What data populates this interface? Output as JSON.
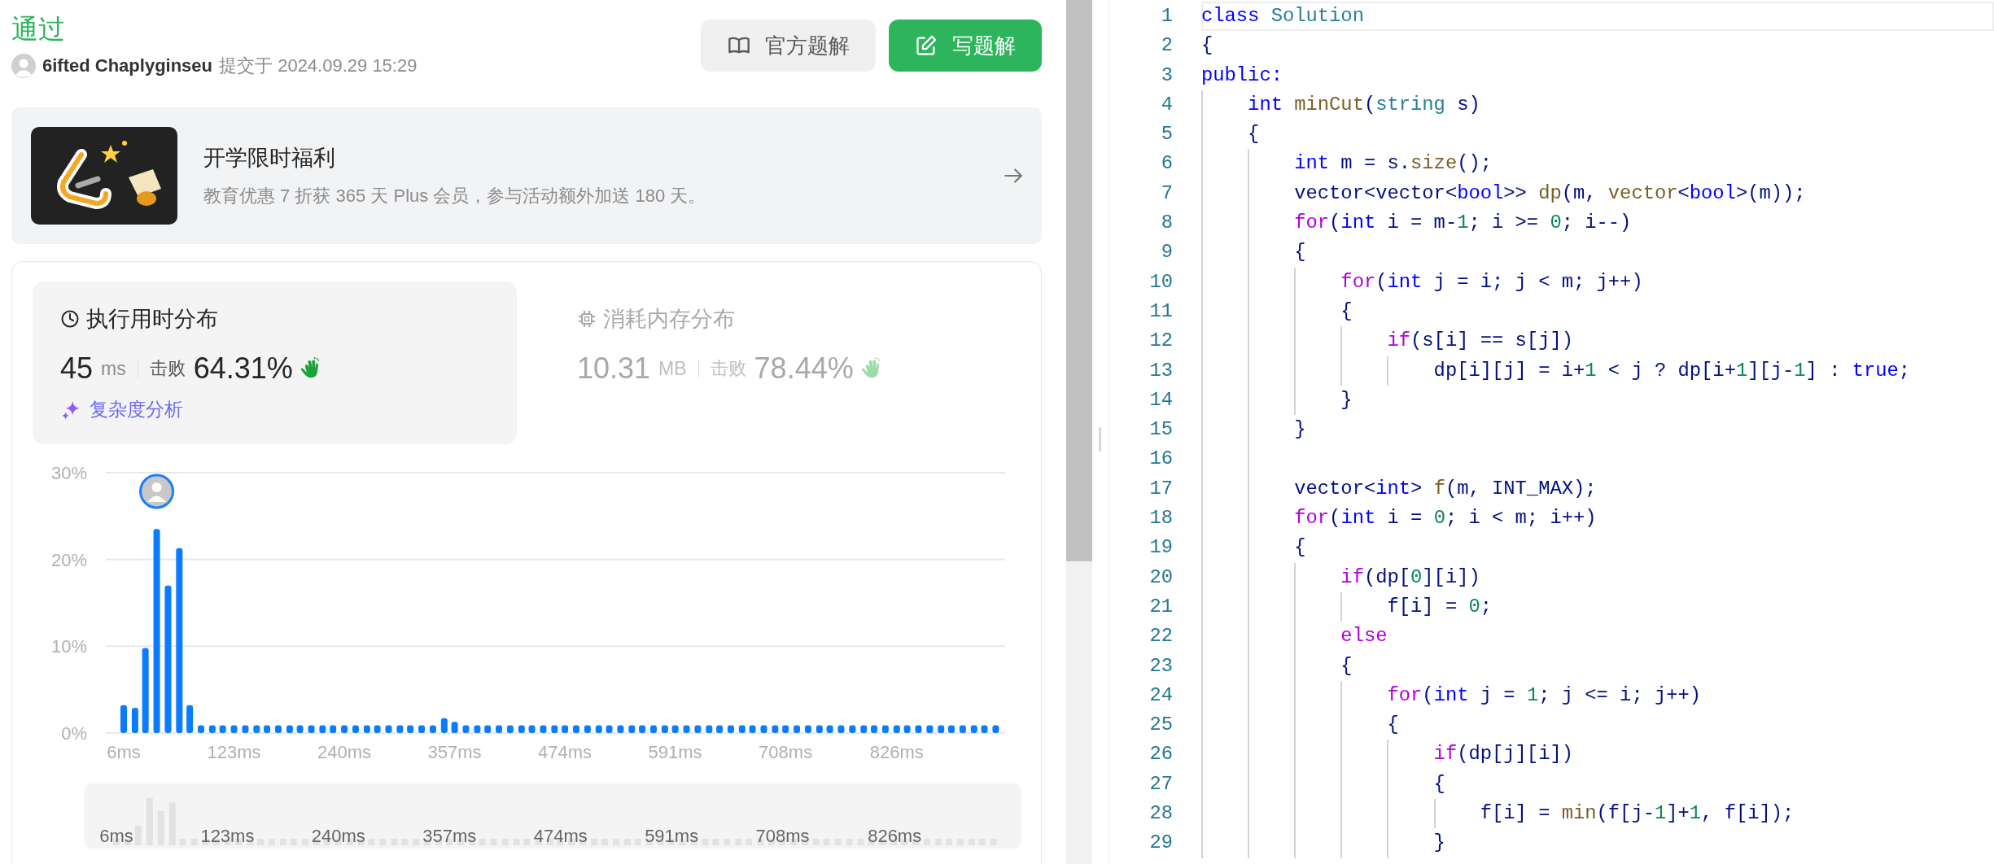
{
  "result": {
    "status": "通过",
    "user": "6ifted Chaplyginseu",
    "submitted": "提交于 2024.09.29 15:29"
  },
  "buttons": [
    {
      "label": "官方题解",
      "kind": "secondary"
    },
    {
      "label": "写题解",
      "kind": "primary"
    }
  ],
  "promo": {
    "title": "开学限时福利",
    "subtitle": "教育优惠 7 折获 365 天 Plus 会员，参与活动额外加送 180 天。"
  },
  "stats_tabs": [
    {
      "kind": "time",
      "title": "执行用时分布",
      "selected": true,
      "value": "45",
      "unit": "ms",
      "beat_label": "击败",
      "percent": "64.31%",
      "link": "复杂度分析"
    },
    {
      "kind": "memory",
      "title": "消耗内存分布",
      "selected": false,
      "value": "10.31",
      "unit": "MB",
      "beat_label": "击败",
      "percent": "78.44%"
    }
  ],
  "chart_data": {
    "type": "bar",
    "x": [
      6,
      18,
      29,
      41,
      53,
      65,
      76,
      88,
      100,
      111,
      123,
      135,
      147,
      158,
      170,
      182,
      193,
      205,
      217,
      228,
      240,
      252,
      264,
      275,
      287,
      299,
      310,
      322,
      334,
      346,
      357,
      369,
      381,
      392,
      404,
      416,
      428,
      439,
      451,
      463,
      474,
      486,
      498,
      510,
      521,
      533,
      545,
      556,
      568,
      580,
      591,
      603,
      615,
      627,
      638,
      650,
      662,
      673,
      685,
      697,
      708,
      720,
      732,
      744,
      755,
      767,
      779,
      791,
      802,
      814,
      826,
      837,
      849,
      861,
      873,
      884,
      896,
      908,
      919,
      931
    ],
    "values": [
      3.2,
      2.9,
      9.8,
      23.5,
      17,
      21.3,
      3.2,
      0.9,
      0.9,
      0.9,
      0.9,
      0.9,
      0.9,
      0.9,
      0.9,
      0.9,
      0.9,
      0.9,
      0.9,
      0.9,
      0.9,
      0.9,
      0.9,
      0.9,
      0.9,
      0.9,
      0.9,
      0.9,
      0.9,
      1.7,
      1.3,
      0.9,
      0.9,
      0.9,
      0.9,
      0.9,
      0.9,
      0.9,
      0.9,
      0.9,
      0.9,
      0.9,
      0.9,
      0.9,
      0.9,
      0.9,
      0.9,
      0.9,
      0.9,
      0.9,
      0.9,
      0.9,
      0.9,
      0.9,
      0.9,
      0.9,
      0.9,
      0.9,
      0.9,
      0.9,
      0.9,
      0.9,
      0.9,
      0.9,
      0.9,
      0.9,
      0.9,
      0.9,
      0.9,
      0.9,
      0.9,
      0.9,
      0.9,
      0.9,
      0.9,
      0.9,
      0.9,
      0.9,
      0.9,
      0.9
    ],
    "xlim": [
      -13,
      941
    ],
    "ylim": [
      0,
      30
    ],
    "yticks": [
      {
        "value": 0,
        "label": "0%"
      },
      {
        "value": 10,
        "label": "10%"
      },
      {
        "value": 20,
        "label": "20%"
      },
      {
        "value": 30,
        "label": "30%"
      }
    ],
    "xticks": [
      {
        "value": 6,
        "label": "6ms"
      },
      {
        "value": 123,
        "label": "123ms"
      },
      {
        "value": 240,
        "label": "240ms"
      },
      {
        "value": 357,
        "label": "357ms"
      },
      {
        "value": 474,
        "label": "474ms"
      },
      {
        "value": 591,
        "label": "591ms"
      },
      {
        "value": 708,
        "label": "708ms"
      },
      {
        "value": 826,
        "label": "826ms"
      }
    ]
  },
  "overview_labels": [
    "6ms",
    "123ms",
    "240ms",
    "357ms",
    "474ms",
    "591ms",
    "708ms",
    "826ms"
  ],
  "code": {
    "lines": [
      {
        "n": "1",
        "current": true,
        "tokens": [
          {
            "kind": "keyword",
            "text": "class"
          },
          {
            "kind": "type",
            "text": " Solution"
          }
        ]
      },
      {
        "n": "2",
        "current": false,
        "tokens": [
          {
            "kind": "plain",
            "text": "{"
          }
        ]
      },
      {
        "n": "3",
        "current": false,
        "tokens": [
          {
            "kind": "keyword",
            "text": "public:"
          }
        ]
      },
      {
        "n": "4",
        "current": false,
        "tokens": [
          {
            "kind": "keyword",
            "text": "    int"
          },
          {
            "kind": "function",
            "text": " minCut"
          },
          {
            "kind": "plain",
            "text": "("
          },
          {
            "kind": "type",
            "text": "string"
          },
          {
            "kind": "plain",
            "text": " s)"
          }
        ]
      },
      {
        "n": "5",
        "current": false,
        "tokens": [
          {
            "kind": "plain",
            "text": "    {"
          }
        ]
      },
      {
        "n": "6",
        "current": false,
        "tokens": [
          {
            "kind": "keyword",
            "text": "        int"
          },
          {
            "kind": "plain",
            "text": " m = s."
          },
          {
            "kind": "function",
            "text": "size"
          },
          {
            "kind": "plain",
            "text": "();"
          }
        ]
      },
      {
        "n": "7",
        "current": false,
        "tokens": [
          {
            "kind": "plain",
            "text": "        vector<vector<"
          },
          {
            "kind": "keyword",
            "text": "bool"
          },
          {
            "kind": "plain",
            "text": ">> "
          },
          {
            "kind": "function",
            "text": "dp"
          },
          {
            "kind": "plain",
            "text": "(m, "
          },
          {
            "kind": "function",
            "text": "vector"
          },
          {
            "kind": "plain",
            "text": "<"
          },
          {
            "kind": "keyword",
            "text": "bool"
          },
          {
            "kind": "plain",
            "text": ">(m));"
          }
        ]
      },
      {
        "n": "8",
        "current": false,
        "tokens": [
          {
            "kind": "control",
            "text": "        for"
          },
          {
            "kind": "plain",
            "text": "("
          },
          {
            "kind": "keyword",
            "text": "int"
          },
          {
            "kind": "plain",
            "text": " i = m-"
          },
          {
            "kind": "number",
            "text": "1"
          },
          {
            "kind": "plain",
            "text": "; i >= "
          },
          {
            "kind": "number",
            "text": "0"
          },
          {
            "kind": "plain",
            "text": "; i--)"
          }
        ]
      },
      {
        "n": "9",
        "current": false,
        "tokens": [
          {
            "kind": "plain",
            "text": "        {"
          }
        ]
      },
      {
        "n": "10",
        "current": false,
        "tokens": [
          {
            "kind": "control",
            "text": "            for"
          },
          {
            "kind": "plain",
            "text": "("
          },
          {
            "kind": "keyword",
            "text": "int"
          },
          {
            "kind": "plain",
            "text": " j = i; j < m; j++)"
          }
        ]
      },
      {
        "n": "11",
        "current": false,
        "tokens": [
          {
            "kind": "plain",
            "text": "            {"
          }
        ]
      },
      {
        "n": "12",
        "current": false,
        "tokens": [
          {
            "kind": "control",
            "text": "                if"
          },
          {
            "kind": "plain",
            "text": "(s[i] == s[j])"
          }
        ]
      },
      {
        "n": "13",
        "current": false,
        "tokens": [
          {
            "kind": "plain",
            "text": "                    dp[i][j] = i+"
          },
          {
            "kind": "number",
            "text": "1"
          },
          {
            "kind": "plain",
            "text": " < j ? dp[i+"
          },
          {
            "kind": "number",
            "text": "1"
          },
          {
            "kind": "plain",
            "text": "][j-"
          },
          {
            "kind": "number",
            "text": "1"
          },
          {
            "kind": "plain",
            "text": "] : "
          },
          {
            "kind": "keyword",
            "text": "true"
          },
          {
            "kind": "plain",
            "text": ";"
          }
        ]
      },
      {
        "n": "14",
        "current": false,
        "tokens": [
          {
            "kind": "plain",
            "text": "            }"
          }
        ]
      },
      {
        "n": "15",
        "current": false,
        "tokens": [
          {
            "kind": "plain",
            "text": "        }"
          }
        ]
      },
      {
        "n": "16"
      },
      {
        "n": "17",
        "current": false,
        "tokens": [
          {
            "kind": "plain",
            "text": "        vector<"
          },
          {
            "kind": "keyword",
            "text": "int"
          },
          {
            "kind": "plain",
            "text": "> "
          },
          {
            "kind": "function",
            "text": "f"
          },
          {
            "kind": "plain",
            "text": "(m, INT_MAX);"
          }
        ]
      },
      {
        "n": "18",
        "current": false,
        "tokens": [
          {
            "kind": "control",
            "text": "        for"
          },
          {
            "kind": "plain",
            "text": "("
          },
          {
            "kind": "keyword",
            "text": "int"
          },
          {
            "kind": "plain",
            "text": " i = "
          },
          {
            "kind": "number",
            "text": "0"
          },
          {
            "kind": "plain",
            "text": "; i < m; i++)"
          }
        ]
      },
      {
        "n": "19",
        "current": false,
        "tokens": [
          {
            "kind": "plain",
            "text": "        {"
          }
        ]
      },
      {
        "n": "20",
        "current": false,
        "tokens": [
          {
            "kind": "control",
            "text": "            if"
          },
          {
            "kind": "plain",
            "text": "(dp["
          },
          {
            "kind": "number",
            "text": "0"
          },
          {
            "kind": "plain",
            "text": "][i])"
          }
        ]
      },
      {
        "n": "21",
        "current": false,
        "tokens": [
          {
            "kind": "plain",
            "text": "                f[i] = "
          },
          {
            "kind": "number",
            "text": "0"
          },
          {
            "kind": "plain",
            "text": ";"
          }
        ]
      },
      {
        "n": "22",
        "current": false,
        "tokens": [
          {
            "kind": "control",
            "text": "            else"
          }
        ]
      },
      {
        "n": "23",
        "current": false,
        "tokens": [
          {
            "kind": "plain",
            "text": "            {"
          }
        ]
      },
      {
        "n": "24",
        "current": false,
        "tokens": [
          {
            "kind": "control",
            "text": "                for"
          },
          {
            "kind": "plain",
            "text": "("
          },
          {
            "kind": "keyword",
            "text": "int"
          },
          {
            "kind": "plain",
            "text": " j = "
          },
          {
            "kind": "number",
            "text": "1"
          },
          {
            "kind": "plain",
            "text": "; j <= i; j++)"
          }
        ]
      },
      {
        "n": "25",
        "current": false,
        "tokens": [
          {
            "kind": "plain",
            "text": "                {"
          }
        ]
      },
      {
        "n": "26",
        "current": false,
        "tokens": [
          {
            "kind": "control",
            "text": "                    if"
          },
          {
            "kind": "plain",
            "text": "(dp[j][i])"
          }
        ]
      },
      {
        "n": "27",
        "current": false,
        "tokens": [
          {
            "kind": "plain",
            "text": "                    {"
          }
        ]
      },
      {
        "n": "28",
        "current": false,
        "tokens": [
          {
            "kind": "plain",
            "text": "                        f[i] = "
          },
          {
            "kind": "function",
            "text": "min"
          },
          {
            "kind": "plain",
            "text": "(f[j-"
          },
          {
            "kind": "number",
            "text": "1"
          },
          {
            "kind": "plain",
            "text": "]+"
          },
          {
            "kind": "number",
            "text": "1"
          },
          {
            "kind": "plain",
            "text": ", f[i]);"
          }
        ]
      },
      {
        "n": "29",
        "current": false,
        "tokens": [
          {
            "kind": "plain",
            "text": "                    }"
          }
        ]
      }
    ]
  }
}
